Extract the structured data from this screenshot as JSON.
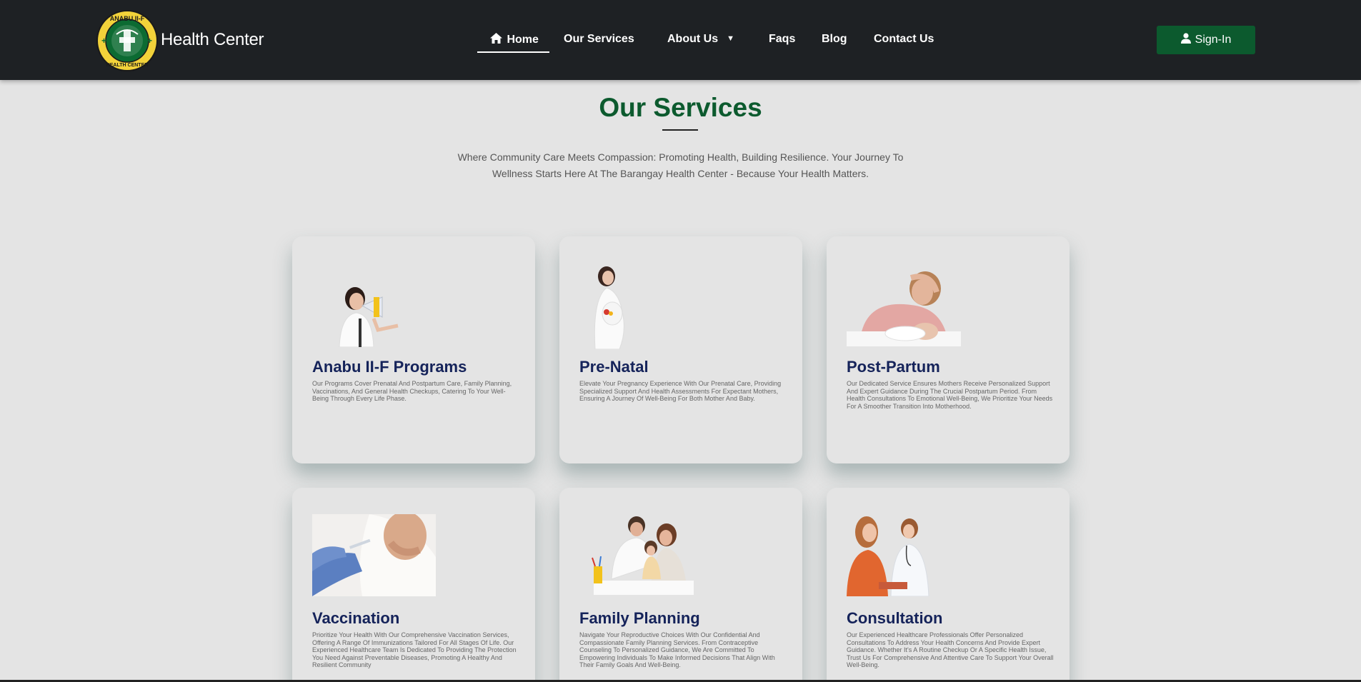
{
  "brand": {
    "logo_text": "ANABU II-F HEALTH CENTER",
    "name": "Health Center"
  },
  "nav": {
    "home": "Home",
    "services": "Our Services",
    "about": "About Us",
    "faqs": "Faqs",
    "blog": "Blog",
    "contact": "Contact Us",
    "signin": "Sign-In"
  },
  "section": {
    "title": "Our Services",
    "intro": "Where Community Care Meets Compassion: Promoting Health, Building Resilience. Your Journey To Wellness Starts Here At The Barangay Health Center - Because Your Health Matters."
  },
  "cards": [
    {
      "title": "Anabu II-F Programs",
      "desc": "Our Programs Cover Prenatal And Postpartum Care, Family Planning, Vaccinations, And General Health Checkups, Catering To Your Well-Being Through Every Life Phase.",
      "icon": "woman-megaphone-image"
    },
    {
      "title": "Pre-Natal",
      "desc": "Elevate Your Pregnancy Experience With Our Prenatal Care, Providing Specialized Support And Health Assessments For Expectant Mothers, Ensuring A Journey Of Well-Being For Both Mother And Baby.",
      "icon": "pregnant-woman-image"
    },
    {
      "title": "Post-Partum",
      "desc": "Our Dedicated Service Ensures Mothers Receive Personalized Support And Expert Guidance During The Crucial Postpartum Period. From Health Consultations To Emotional Well-Being, We Prioritize Your Needs For A Smoother Transition Into Motherhood.",
      "icon": "mother-baby-image"
    },
    {
      "title": "Vaccination",
      "desc": "Prioritize Your Health With Our Comprehensive Vaccination Services, Offering A Range Of Immunizations Tailored For All Stages Of Life. Our Experienced Healthcare Team Is Dedicated To Providing The Protection You Need Against Preventable Diseases, Promoting A Healthy And Resilient Community",
      "icon": "vaccination-image"
    },
    {
      "title": "Family Planning",
      "desc": "Navigate Your Reproductive Choices With Our Confidential And Compassionate Family Planning Services. From Contraceptive Counseling To Personalized Guidance, We Are Committed To Empowering Individuals To Make Informed Decisions That Align With Their Family Goals And Well-Being.",
      "icon": "family-image"
    },
    {
      "title": "Consultation",
      "desc": "Our Experienced Healthcare Professionals Offer Personalized Consultations To Address Your Health Concerns And Provide Expert Guidance. Whether It's A Routine Checkup Or A Specific Health Issue, Trust Us For Comprehensive And Attentive Care To Support Your Overall Well-Being.",
      "icon": "doctor-patient-image"
    }
  ],
  "colors": {
    "navbar": "#1e2124",
    "accent_green": "#0c5a2e",
    "card_title": "#15235a",
    "background": "#e4e4e4"
  }
}
